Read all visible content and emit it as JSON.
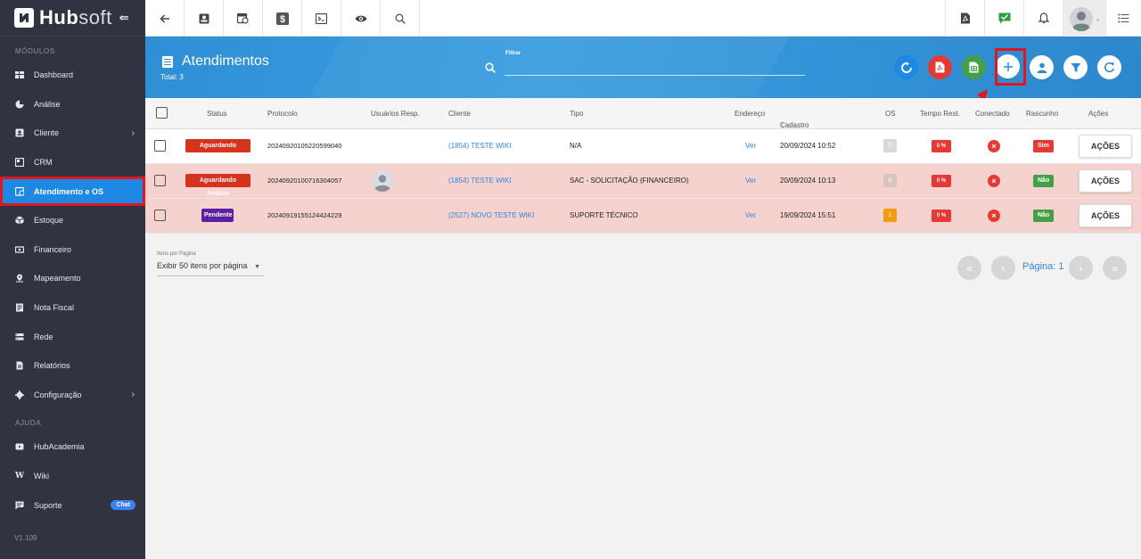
{
  "app": {
    "logo_text": "Hub",
    "logo_text_soft": "soft"
  },
  "sidebar": {
    "section_modules": "MÓDULOS",
    "items": [
      {
        "label": "Dashboard"
      },
      {
        "label": "Análise"
      },
      {
        "label": "Cliente"
      },
      {
        "label": "CRM"
      },
      {
        "label": "Atendimento e OS"
      },
      {
        "label": "Estoque"
      },
      {
        "label": "Financeiro"
      },
      {
        "label": "Mapeamento"
      },
      {
        "label": "Nota Fiscal"
      },
      {
        "label": "Rede"
      },
      {
        "label": "Relatórios"
      },
      {
        "label": "Configuração"
      }
    ],
    "section_help": "AJUDA",
    "help_items": [
      {
        "label": "HubAcademia"
      },
      {
        "label": "Wiki"
      },
      {
        "label": "Suporte",
        "badge": "Chat"
      }
    ],
    "version": "V1.109"
  },
  "header": {
    "title": "Atendimentos",
    "total": "Total: 3",
    "filter_label": "Filtrar",
    "filter_value": ""
  },
  "table": {
    "columns": [
      "Status",
      "Protocolo",
      "Usuários Resp.",
      "Cliente",
      "Tipo",
      "Endereço",
      "Cadastro",
      "OS",
      "Tempo Rest.",
      "Conectado",
      "Rascunho",
      "Ações"
    ],
    "rows": [
      {
        "status": "Aguardando Análise",
        "protocolo": "20240920105220599040",
        "cliente": "(1854) TESTE WIKI",
        "tipo": "N/A",
        "endereco": "Ver",
        "cadastro": "20/09/2024 10:52",
        "os": "0",
        "tempo": "0 %",
        "rascunho": "Sim",
        "acoes": "AÇÕES"
      },
      {
        "status": "Aguardando Análise",
        "protocolo": "20240920100716304057",
        "cliente": "(1854) TESTE WIKI",
        "tipo": "SAC - SOLICITAÇÃO (FINANCEIRO)",
        "endereco": "Ver",
        "cadastro": "20/09/2024 10:13",
        "os": "0",
        "tempo": "0 %",
        "rascunho": "Não",
        "acoes": "AÇÕES"
      },
      {
        "status": "Pendente",
        "protocolo": "20240919155124424229",
        "cliente": "(2527) NOVO TESTE WIKI",
        "tipo": "SUPORTE TÉCNICO",
        "endereco": "Ver",
        "cadastro": "19/09/2024 15:51",
        "os": "1",
        "tempo": "0 %",
        "rascunho": "Não",
        "acoes": "AÇÕES"
      }
    ]
  },
  "pagination": {
    "per_page_label": "Itens por Página",
    "per_page_value": "Exibir 50 itens por página",
    "page_label": "Página: 1"
  },
  "colors": {
    "sidebar_bg": "#2f3440",
    "accent": "#1e88e5",
    "highlight": "#e3161d",
    "row_pink": "#f6d2cf"
  }
}
